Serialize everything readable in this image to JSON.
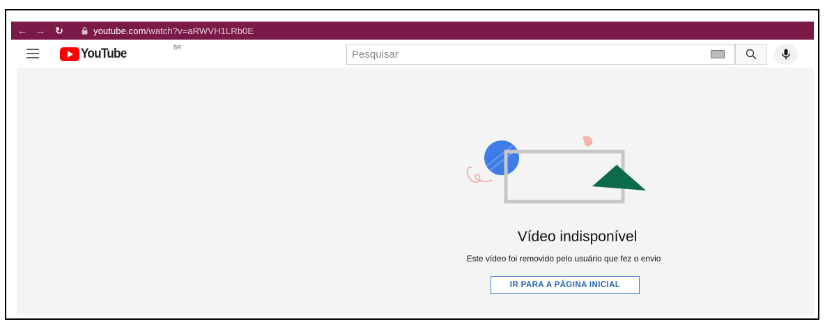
{
  "browser": {
    "url_host": "youtube.com",
    "url_path": "/watch?v=aRWVH1LRb0E",
    "back_icon": "arrow-left-icon",
    "forward_icon": "arrow-right-icon",
    "reload_icon": "reload-icon",
    "lock_icon": "lock-icon",
    "accent_color": "#7b1a48"
  },
  "header": {
    "logo_text": "YouTube",
    "country_code": "BR",
    "search_placeholder": "Pesquisar",
    "menu_icon": "hamburger-menu-icon",
    "keyboard_icon": "keyboard-icon",
    "search_icon": "search-icon",
    "mic_icon": "microphone-icon"
  },
  "main": {
    "title": "Vídeo indisponível",
    "reason": "Este vídeo foi removido pelo usuário que fez o envio",
    "home_button": "IR PARA A PÁGINA INICIAL",
    "illustration": "unavailable-video-illustration-icon",
    "button_color": "#2565ae"
  }
}
